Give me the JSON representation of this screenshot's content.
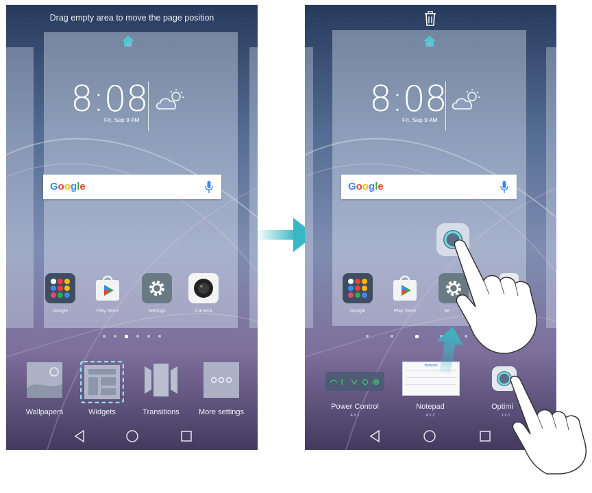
{
  "left_screen": {
    "hint": "Drag empty area to move the page position",
    "clock_time": "8:08",
    "clock_date": "Fri, Sep 9 AM",
    "search_logo": "Google",
    "apps": [
      {
        "label": "Google",
        "icon": "google-folder-icon"
      },
      {
        "label": "Play Store",
        "icon": "play-store-icon"
      },
      {
        "label": "Settings",
        "icon": "settings-gear-icon"
      },
      {
        "label": "Camera",
        "icon": "camera-icon"
      }
    ],
    "page_dots": {
      "count": 6,
      "active": 3
    },
    "tools": [
      {
        "label": "Wallpapers",
        "icon": "wallpapers-icon"
      },
      {
        "label": "Widgets",
        "icon": "widgets-icon",
        "highlighted": true
      },
      {
        "label": "Transitions",
        "icon": "transitions-icon"
      },
      {
        "label": "More settings",
        "icon": "more-settings-icon"
      }
    ]
  },
  "right_screen": {
    "clock_time": "8:08",
    "clock_date": "Fri, Sep 9 AM",
    "search_logo": "Google",
    "apps": [
      {
        "label": "Google",
        "icon": "google-folder-icon"
      },
      {
        "label": "Play Store",
        "icon": "play-store-icon"
      },
      {
        "label": "Se",
        "icon": "settings-gear-icon"
      }
    ],
    "widgets": [
      {
        "label": "Power Control",
        "size": "4 x 1"
      },
      {
        "label": "Notepad",
        "size": "4 x 2"
      },
      {
        "label": "Optimi",
        "size": "1 x 1"
      }
    ],
    "notepad_title": "Notepad"
  },
  "colors": {
    "accent": "#38b8c4",
    "highlight": "#8fe3ea"
  }
}
